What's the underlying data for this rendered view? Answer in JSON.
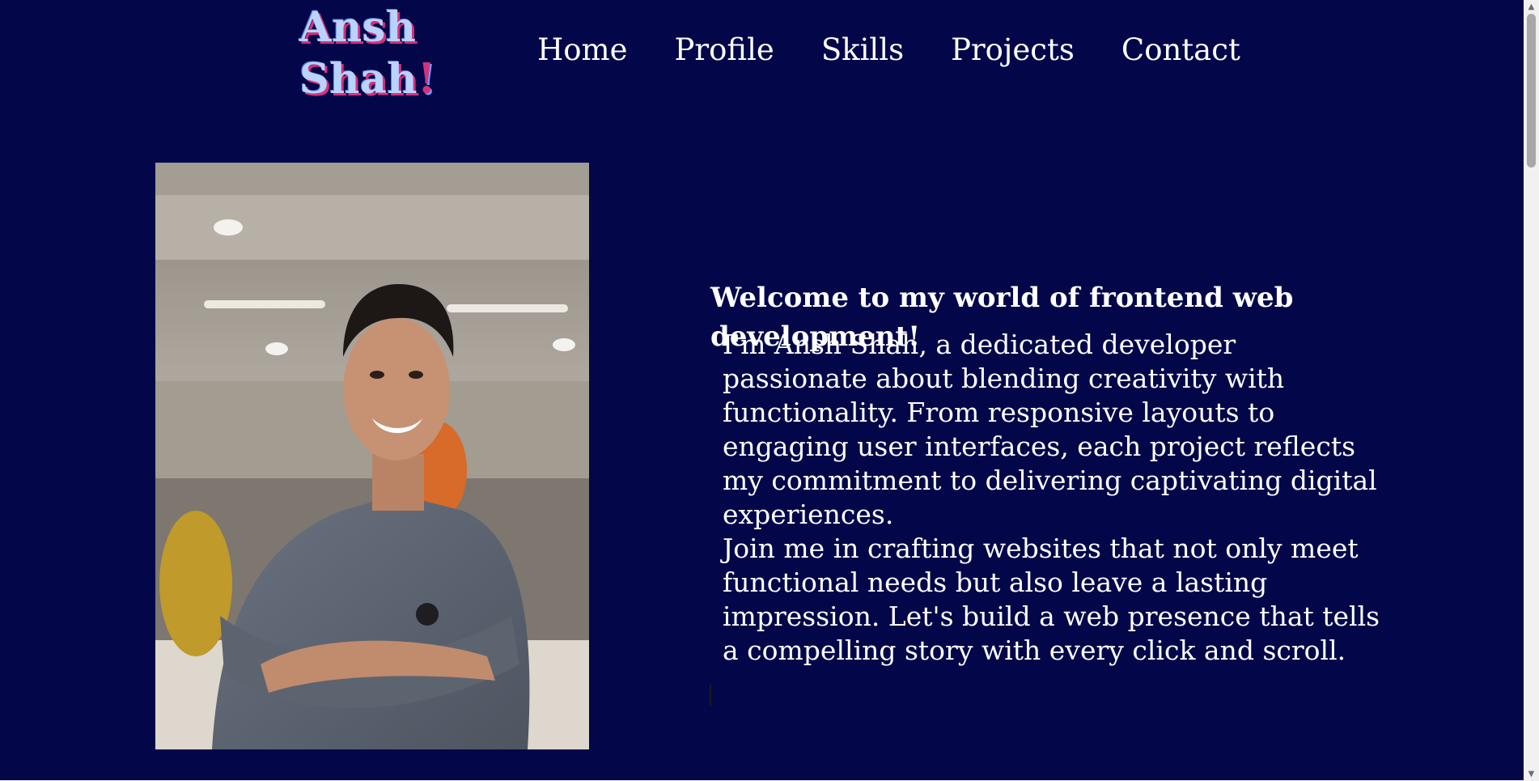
{
  "header": {
    "logo_first": "Ansh",
    "logo_last": "Shah",
    "logo_mark": "!",
    "nav": [
      {
        "label": "Home"
      },
      {
        "label": "Profile"
      },
      {
        "label": "Skills"
      },
      {
        "label": "Projects"
      },
      {
        "label": "Contact"
      }
    ]
  },
  "intro": {
    "welcome": "Welcome to my world of frontend web development!",
    "paragraph_1": "I'm Ansh Shah, a dedicated developer passionate about blending creativity with functionality. From responsive layouts to engaging user interfaces, each project reflects my commitment to delivering captivating digital experiences.",
    "paragraph_2": "Join me in crafting websites that not only meet functional needs but also leave a lasting impression. Let's build a web presence that tells a compelling story with every click and scroll."
  },
  "colors": {
    "background": "#03074a",
    "text": "#ffffff",
    "logo_fill": "#b9d3ff",
    "logo_accent": "#d6307b"
  },
  "icons": {
    "scroll_up": "triangle-up-icon",
    "scroll_down": "triangle-down-icon"
  }
}
